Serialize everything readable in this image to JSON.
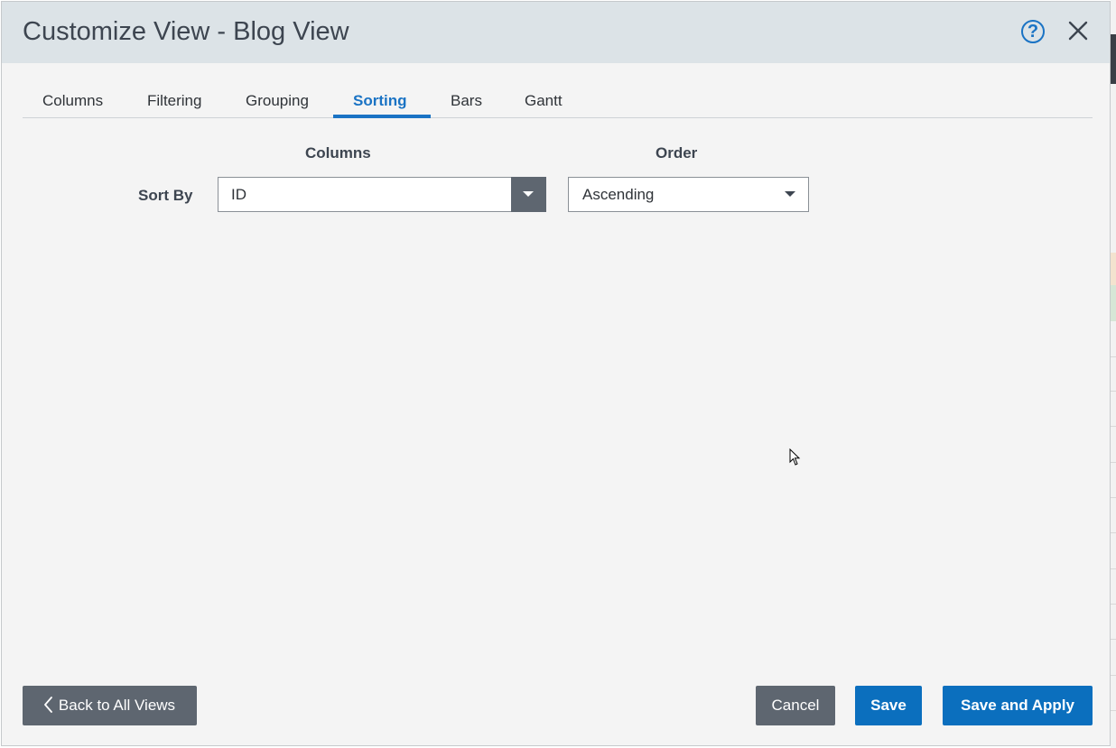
{
  "dialog": {
    "title": "Customize View - Blog View",
    "help_symbol": "?",
    "help_icon": "question-circle-icon",
    "close_icon": "close-x-icon"
  },
  "tabs": [
    {
      "label": "Columns",
      "active": false
    },
    {
      "label": "Filtering",
      "active": false
    },
    {
      "label": "Grouping",
      "active": false
    },
    {
      "label": "Sorting",
      "active": true
    },
    {
      "label": "Bars",
      "active": false
    },
    {
      "label": "Gantt",
      "active": false
    }
  ],
  "sorting": {
    "columns_header": "Columns",
    "order_header": "Order",
    "sort_by_label": "Sort By",
    "column_value": "ID",
    "order_value": "Ascending"
  },
  "footer": {
    "back_label": "Back to All Views",
    "cancel_label": "Cancel",
    "save_label": "Save",
    "save_apply_label": "Save and Apply"
  },
  "colors": {
    "accent": "#1a73c4",
    "primary_button": "#0b6fbe",
    "secondary_button": "#5e6670",
    "title_bar": "#dce3e7"
  }
}
